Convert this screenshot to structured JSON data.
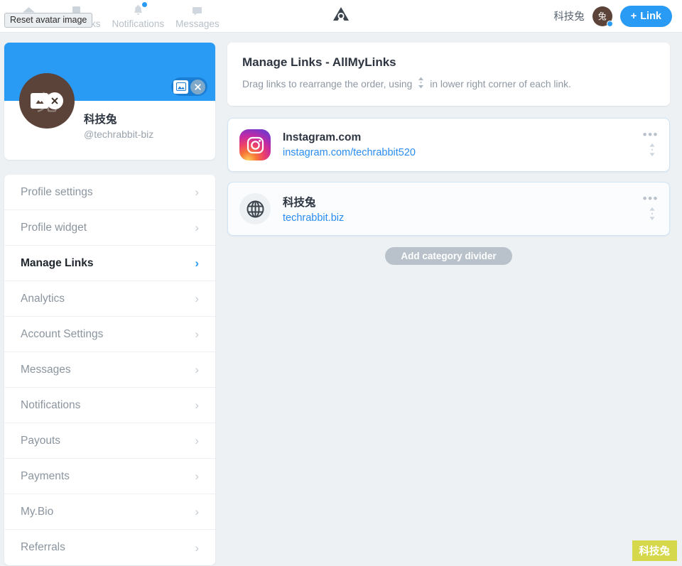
{
  "topnav": {
    "items": [
      {
        "label": "Home",
        "icon": "home-icon"
      },
      {
        "label": "Bookmarks",
        "icon": "bookmark-icon"
      },
      {
        "label": "Notifications",
        "icon": "bell-icon",
        "has_dot": true
      },
      {
        "label": "Messages",
        "icon": "message-icon"
      }
    ],
    "logo_name": "allmylinks-logo",
    "username": "科技兔",
    "avatar_initial": "兔",
    "add_link_label": "Link",
    "add_link_plus": "+"
  },
  "tooltip": {
    "text": "Reset avatar image"
  },
  "profile": {
    "name": "科技兔",
    "handle": "@techrabbit-biz",
    "avatar_initial": "兔",
    "cover_color": "#2a9bf4"
  },
  "sidebar": {
    "items": [
      {
        "label": "Profile settings",
        "active": false
      },
      {
        "label": "Profile widget",
        "active": false
      },
      {
        "label": "Manage Links",
        "active": true
      },
      {
        "label": "Analytics",
        "active": false
      },
      {
        "label": "Account Settings",
        "active": false
      },
      {
        "label": "Messages",
        "active": false
      },
      {
        "label": "Notifications",
        "active": false
      },
      {
        "label": "Payouts",
        "active": false
      },
      {
        "label": "Payments",
        "active": false
      },
      {
        "label": "My.Bio",
        "active": false
      },
      {
        "label": "Referrals",
        "active": false
      }
    ],
    "chevron": "›"
  },
  "main": {
    "title": "Manage Links - AllMyLinks",
    "subtitle_before": "Drag links to rearrange the order, using",
    "subtitle_after": "in lower right corner of each link.",
    "links": [
      {
        "title": "Instagram.com",
        "url": "instagram.com/techrabbit520",
        "icon": "instagram-icon"
      },
      {
        "title": "科技兔",
        "url": "techrabbit.biz",
        "icon": "globe-icon"
      }
    ],
    "add_divider_label": "Add category divider",
    "menu_dots": "•••"
  },
  "corner_badge": {
    "text": "科技兔",
    "color": "#d4d84a"
  }
}
